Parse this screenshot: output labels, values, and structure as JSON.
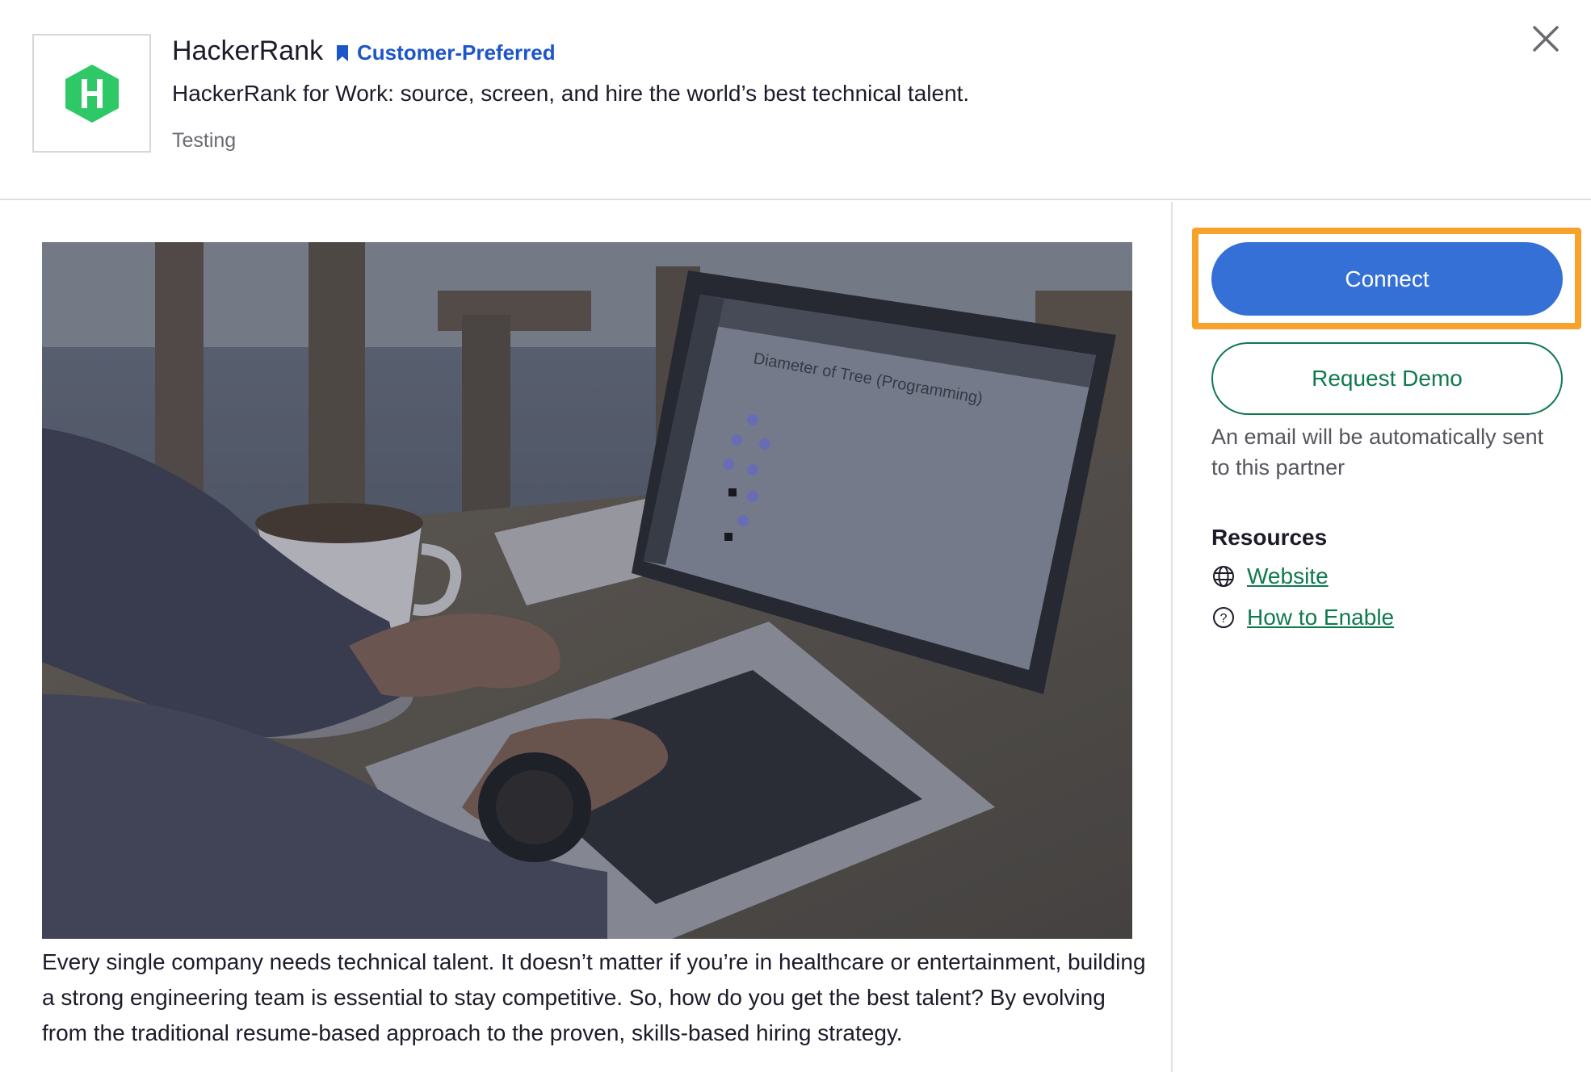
{
  "header": {
    "app_name": "HackerRank",
    "badge": {
      "icon": "bookmark-icon",
      "label": "Customer-Preferred",
      "color": "#1d56c8"
    },
    "tagline": "HackerRank for Work: source, screen, and hire the world’s best technical talent.",
    "category": "Testing",
    "logo": {
      "icon": "hackerrank-logo-icon",
      "letter": "H",
      "color": "#2ec866"
    },
    "close_icon": "close-icon"
  },
  "main": {
    "hero_image": {
      "alt": "person typing on a laptop showing a HackerRank coding challenge",
      "screen_title": "Diameter of Tree (Programming)"
    },
    "description": "Every single company needs technical talent. It doesn’t matter if you’re in healthcare or entertainment, building a strong engineering team is essential to stay competitive. So, how do you get the best talent? By evolving from the traditional resume-based approach to the proven, skills-based hiring strategy."
  },
  "sidebar": {
    "connect_label": "Connect",
    "request_demo_label": "Request Demo",
    "note": "An email will be automatically sent to this partner",
    "resources_title": "Resources",
    "resources": [
      {
        "label": "Website",
        "icon": "globe-icon"
      },
      {
        "label": "How to Enable",
        "icon": "help-circle-icon"
      }
    ]
  },
  "colors": {
    "primary": "#3570d6",
    "success": "#0f7a4d",
    "focus_ring": "#f7a22b",
    "brand_green": "#2ec866"
  }
}
